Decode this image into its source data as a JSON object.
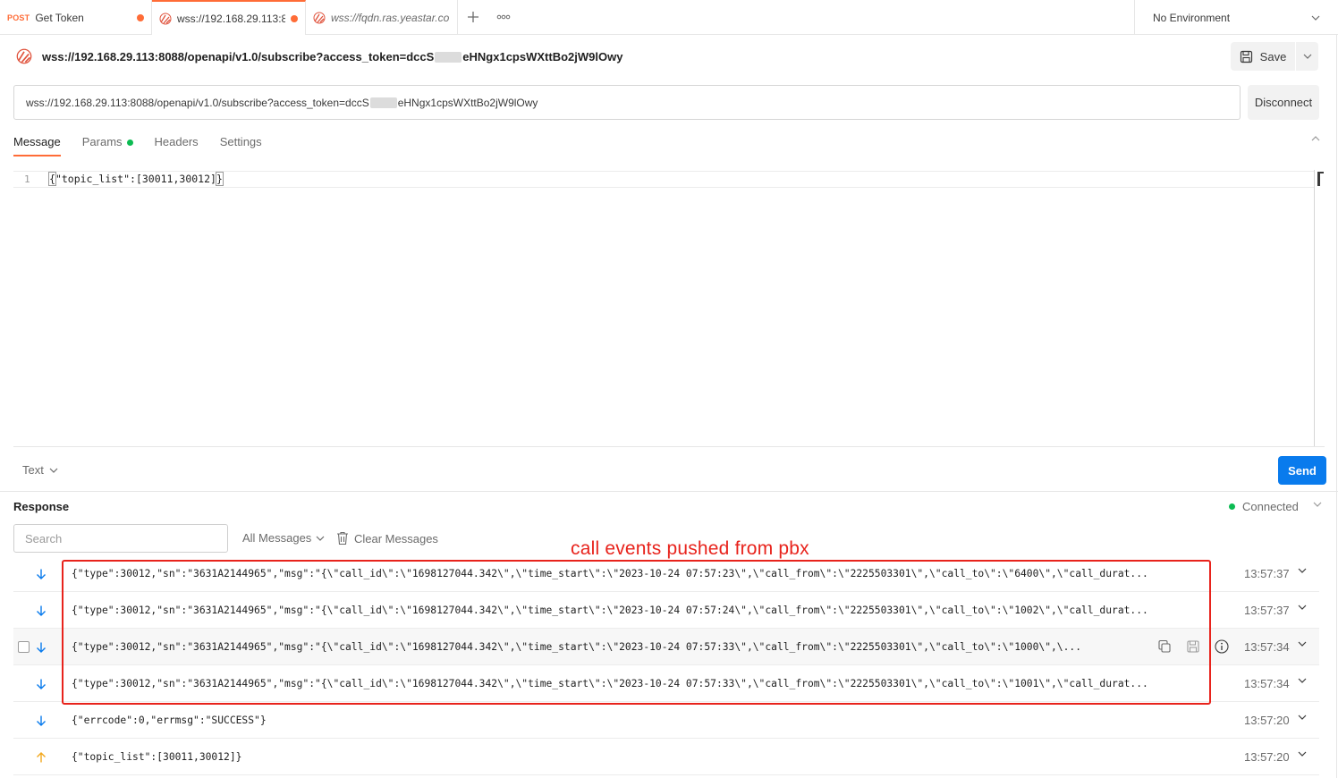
{
  "tabs": [
    {
      "method": "POST",
      "label": "Get Token",
      "unsaved": true
    },
    {
      "label": "wss://192.168.29.113:8(",
      "unsaved": true,
      "active": true
    },
    {
      "label": "wss://fqdn.ras.yeastar.co"
    }
  ],
  "environment": {
    "selected": "No Environment"
  },
  "request": {
    "title_prefix": "wss://192.168.29.113:8088/openapi/v1.0/subscribe?access_token=dccS",
    "title_suffix": "eHNgx1cpsWXttBo2jW9lOwy",
    "url_prefix": "wss://192.168.29.113:8088/openapi/v1.0/subscribe?access_token=dccS",
    "url_suffix": "eHNgx1cpsWXttBo2jW9lOwy",
    "save_label": "Save",
    "disconnect_label": "Disconnect"
  },
  "subtabs": {
    "message": "Message",
    "params": "Params",
    "headers": "Headers",
    "settings": "Settings"
  },
  "editor": {
    "line_number": "1",
    "open_brace": "{",
    "body": "\"topic_list\":[30011,30012]",
    "close_brace": "}"
  },
  "format": {
    "selected": "Text",
    "send_label": "Send"
  },
  "response": {
    "title": "Response",
    "status": "Connected",
    "search_placeholder": "Search",
    "filter": "All Messages",
    "clear": "Clear Messages",
    "annotation": "call events pushed from pbx",
    "messages": [
      {
        "direction": "incoming",
        "text": "{\"type\":30012,\"sn\":\"3631A2144965\",\"msg\":\"{\\\"call_id\\\":\\\"1698127044.342\\\",\\\"time_start\\\":\\\"2023-10-24 07:57:23\\\",\\\"call_from\\\":\\\"2225503301\\\",\\\"call_to\\\":\\\"6400\\\",\\\"call_durat...",
        "time": "13:57:37"
      },
      {
        "direction": "incoming",
        "text": "{\"type\":30012,\"sn\":\"3631A2144965\",\"msg\":\"{\\\"call_id\\\":\\\"1698127044.342\\\",\\\"time_start\\\":\\\"2023-10-24 07:57:24\\\",\\\"call_from\\\":\\\"2225503301\\\",\\\"call_to\\\":\\\"1002\\\",\\\"call_durat...",
        "time": "13:57:37"
      },
      {
        "direction": "incoming",
        "text": "{\"type\":30012,\"sn\":\"3631A2144965\",\"msg\":\"{\\\"call_id\\\":\\\"1698127044.342\\\",\\\"time_start\\\":\\\"2023-10-24 07:57:33\\\",\\\"call_from\\\":\\\"2225503301\\\",\\\"call_to\\\":\\\"1000\\\",\\...",
        "time": "13:57:34"
      },
      {
        "direction": "incoming",
        "text": "{\"type\":30012,\"sn\":\"3631A2144965\",\"msg\":\"{\\\"call_id\\\":\\\"1698127044.342\\\",\\\"time_start\\\":\\\"2023-10-24 07:57:33\\\",\\\"call_from\\\":\\\"2225503301\\\",\\\"call_to\\\":\\\"1001\\\",\\\"call_durat...",
        "time": "13:57:34"
      },
      {
        "direction": "incoming",
        "text": "{\"errcode\":0,\"errmsg\":\"SUCCESS\"}",
        "time": "13:57:20"
      },
      {
        "direction": "outgoing",
        "text": "{\"topic_list\":[30011,30012]}",
        "time": "13:57:20"
      }
    ]
  },
  "colors": {
    "accent": "#ff6c37",
    "send": "#097bed",
    "connected": "#0cbb52",
    "annotation": "#e8231c",
    "incoming": "#097bed",
    "outgoing": "#f2a81d"
  }
}
